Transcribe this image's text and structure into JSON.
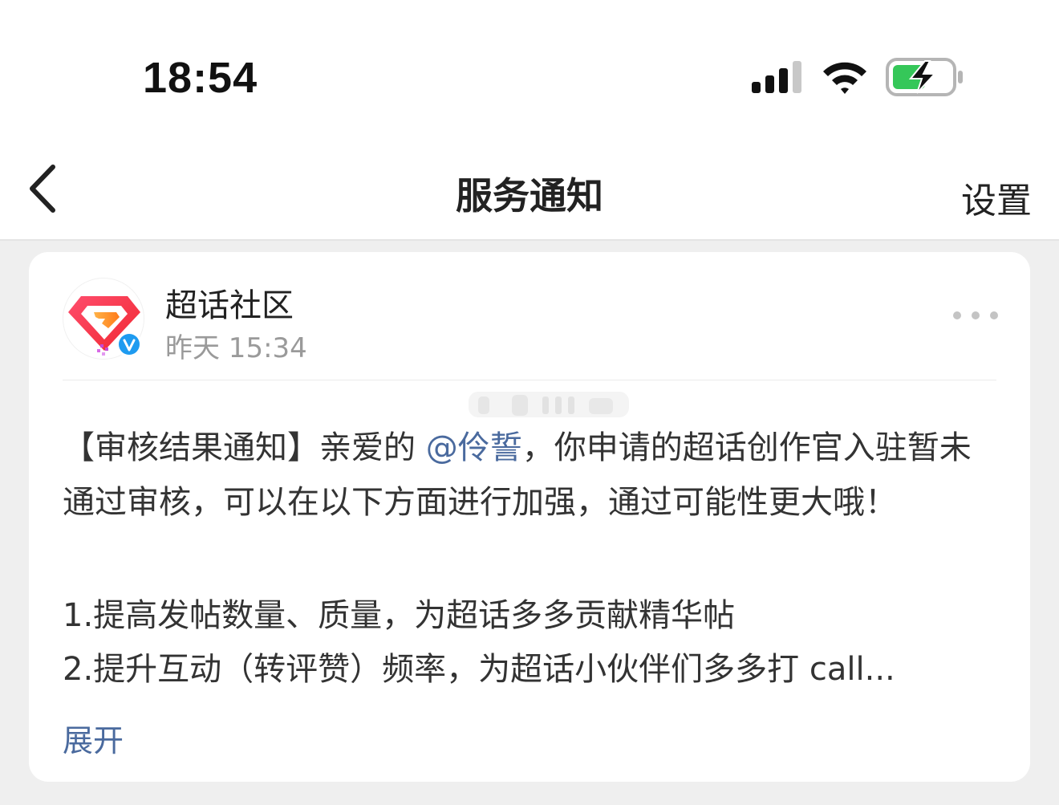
{
  "status_bar": {
    "time": "18:54",
    "signal_icon": "cellular-signal-icon",
    "wifi_icon": "wifi-icon",
    "battery_icon": "battery-charging-icon",
    "battery_color": "#35c759"
  },
  "nav": {
    "back_icon": "chevron-left-icon",
    "title": "服务通知",
    "settings_label": "设置"
  },
  "card": {
    "avatar_icon": "super-topic-diamond-logo",
    "verified_icon": "verified-v-badge-icon",
    "sender_name": "超话社区",
    "timestamp": "昨天 15:34",
    "more_icon": "more-dots-icon",
    "message": {
      "prefix": "【审核结果通知】亲爱的 ",
      "mention": "@伶誓",
      "suffix": "，你申请的超话创作官入驻暂未通过审核，可以在以下方面进行加强，通过可能性更大哦！"
    },
    "items": [
      "1.提高发帖数量、质量，为超话多多贡献精华帖",
      "2.提升互动（转评赞）频率，为超话小伙伴们多多打 call..."
    ],
    "expand_label": "展开"
  },
  "colors": {
    "link": "#4a6a9e",
    "verified_blue": "#1e9bf0",
    "logo_red": "#f5314b",
    "logo_orange": "#ff8a2a",
    "logo_purple": "#c54bd8"
  }
}
